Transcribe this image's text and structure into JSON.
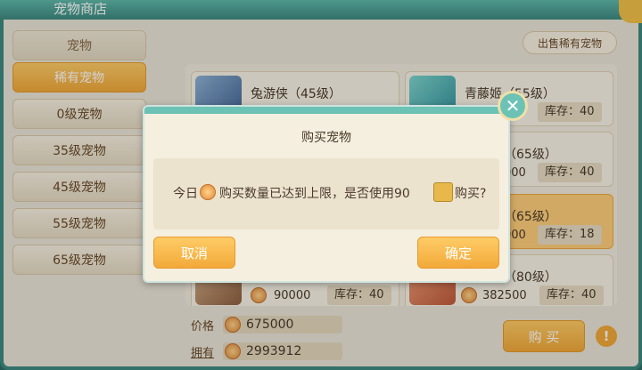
{
  "window": {
    "title": "宠物商店"
  },
  "sidebar": {
    "header": "宠物",
    "items": [
      {
        "label": "稀有宠物",
        "active": true
      },
      {
        "label": "0级宠物"
      },
      {
        "label": "35级宠物"
      },
      {
        "label": "45级宠物"
      },
      {
        "label": "55级宠物"
      },
      {
        "label": "65级宠物"
      }
    ]
  },
  "sell_button": "出售稀有宠物",
  "pets": [
    {
      "name": "兔游侠（45级）"
    },
    {
      "name": "青藤姬（55级）",
      "stock": "库存：40"
    },
    {
      "name_partial": "（65级）",
      "price_partial": "000",
      "stock": "库存：40"
    },
    {
      "name_partial": "（65级）",
      "price_partial": "000",
      "stock": "库存：18"
    },
    {
      "price": "90000",
      "stock": "库存：40"
    },
    {
      "name_partial": "（80级）",
      "price": "382500",
      "stock": "库存：40"
    }
  ],
  "bottom": {
    "price_label": "价格",
    "price_value": "675000",
    "owned_label": "拥有",
    "owned_value": "2993912",
    "buy_button": "购 买",
    "info": "!"
  },
  "dialog": {
    "title": "购买宠物",
    "message_prefix": "今日",
    "message_mid": "购买数量已达到上限，是否使用90",
    "message_suffix": "购买?",
    "cancel": "取消",
    "confirm": "确定",
    "close": "✕"
  }
}
